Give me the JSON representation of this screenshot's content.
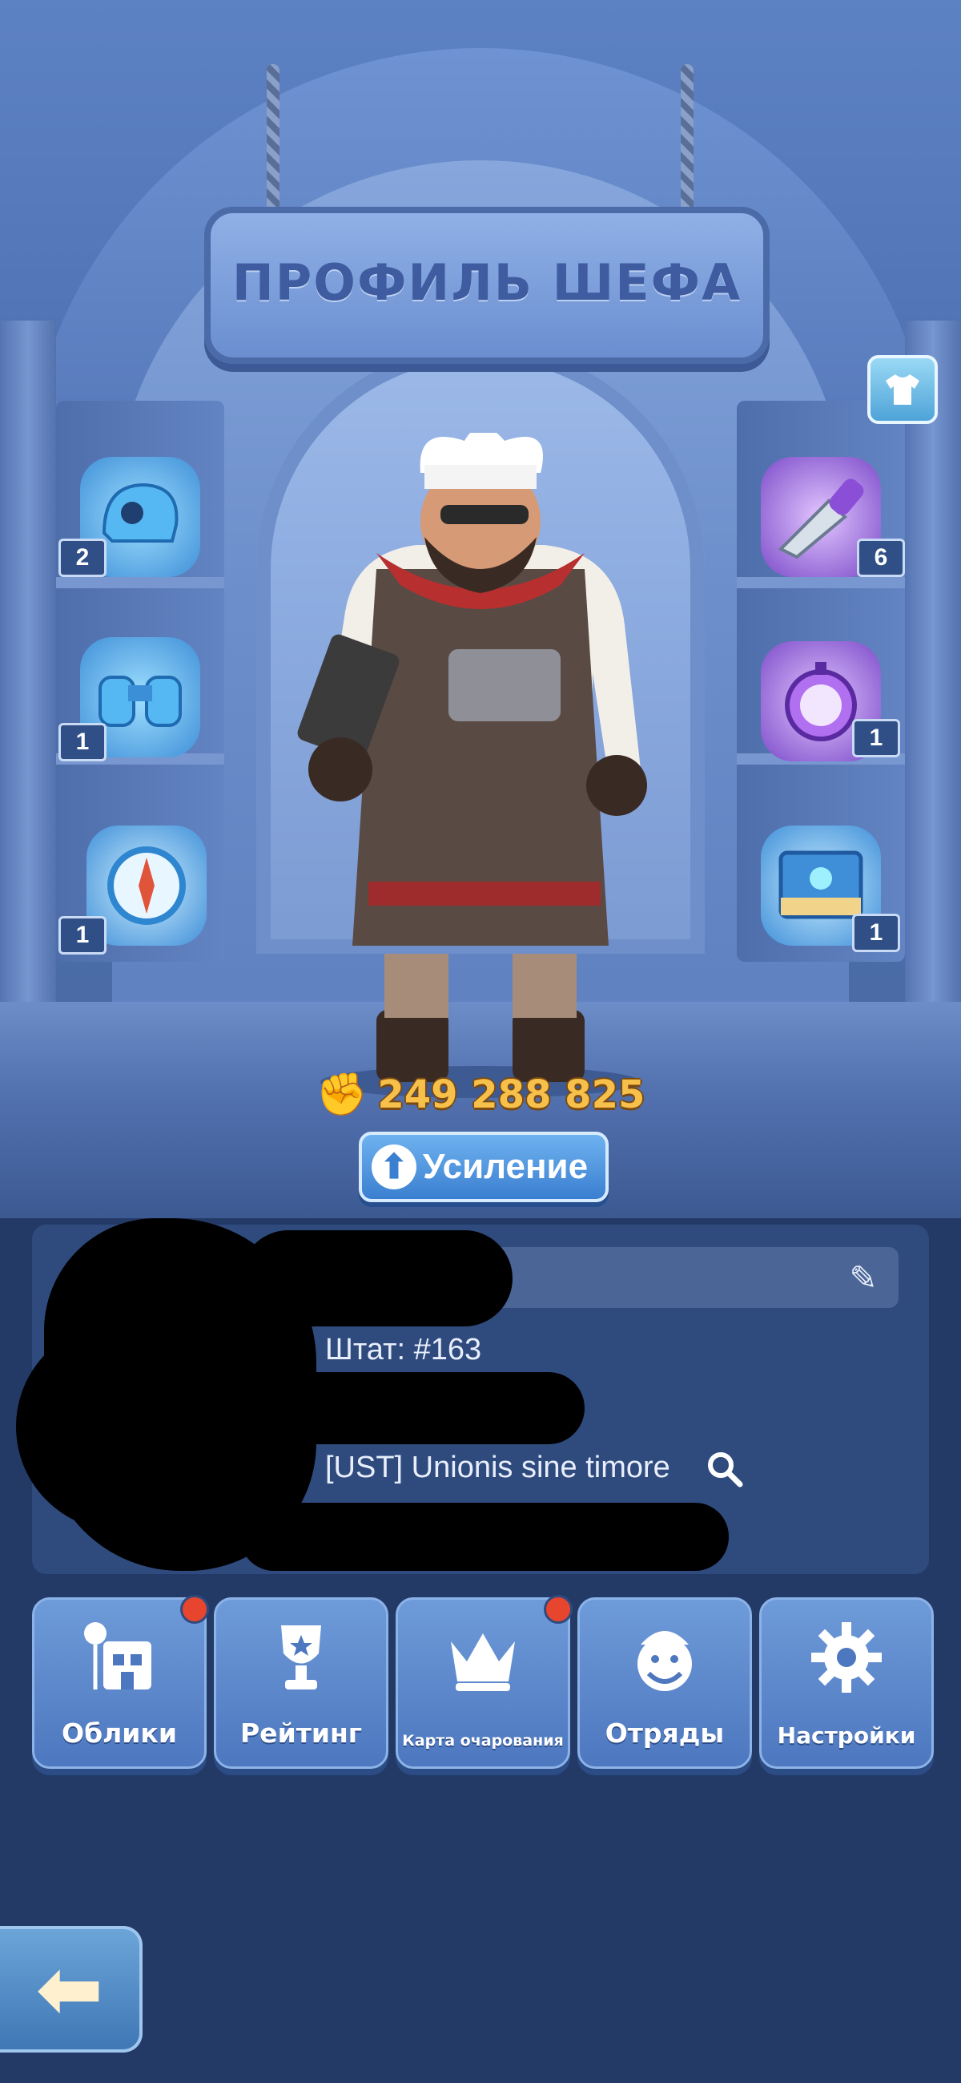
{
  "header": {
    "title": "ПРОФИЛЬ ШЕФА"
  },
  "outfit_button": {
    "icon": "shirt-icon"
  },
  "left_shelf": [
    {
      "icon": "helmet-icon",
      "count": "2"
    },
    {
      "icon": "binoculars-icon",
      "count": "1"
    },
    {
      "icon": "compass-icon",
      "count": "1"
    }
  ],
  "right_shelf": [
    {
      "icon": "cleaver-icon",
      "count": "6"
    },
    {
      "icon": "pocket-watch-icon",
      "count": "1"
    },
    {
      "icon": "book-icon",
      "count": "1"
    }
  ],
  "power": {
    "icon": "fist-icon",
    "value": "249 288 825"
  },
  "boost_button": {
    "label": "Усиление"
  },
  "profile": {
    "staff": "Штат: #163",
    "guild": "[UST] Unionis sine timore"
  },
  "menu": [
    {
      "label": "Облики",
      "icon": "building-icon",
      "notification": true
    },
    {
      "label": "Рейтинг",
      "icon": "trophy-icon",
      "notification": false
    },
    {
      "label": "Карта очарования",
      "icon": "crown-icon",
      "notification": true
    },
    {
      "label": "Отряды",
      "icon": "chef-face-icon",
      "notification": false
    },
    {
      "label": "Настройки",
      "icon": "gear-icon",
      "notification": false
    }
  ],
  "back_button": {
    "icon": "back-arrow-icon"
  },
  "colors": {
    "accent": "#3a7fd0",
    "power": "#f7c04a",
    "notification": "#e8452e"
  }
}
